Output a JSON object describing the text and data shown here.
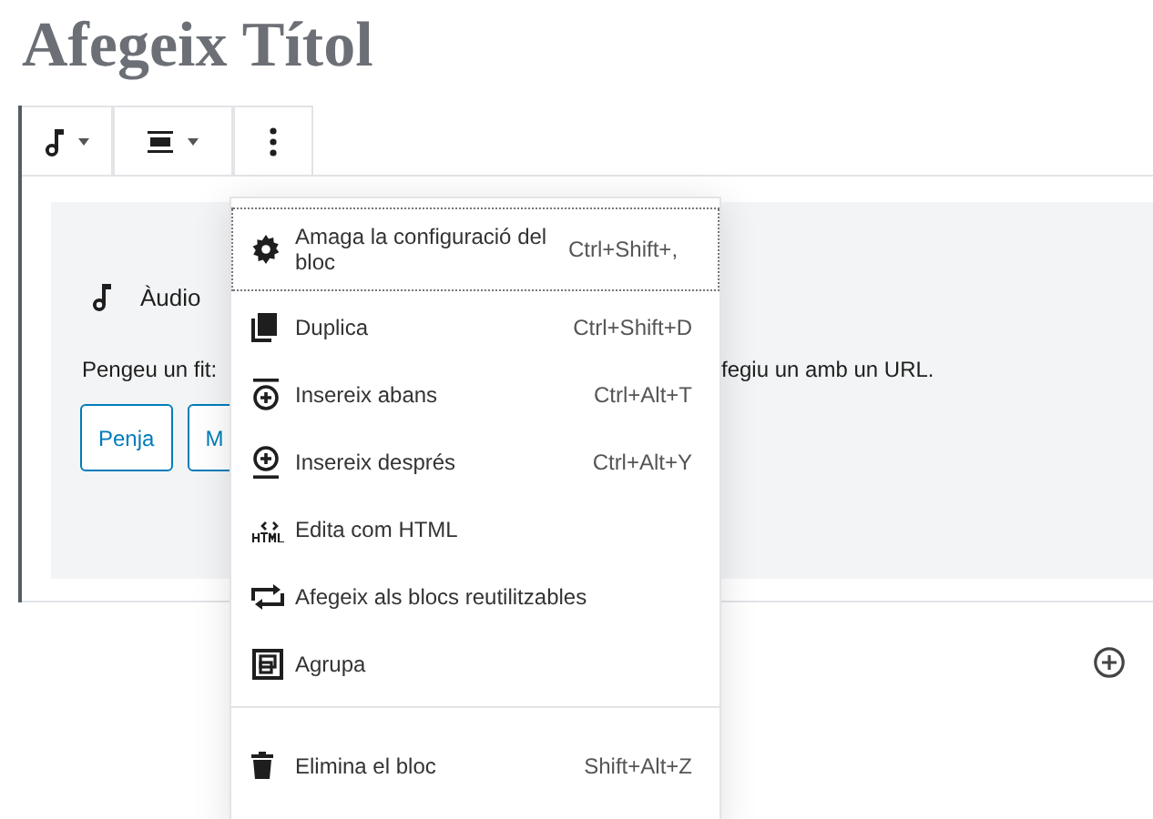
{
  "title": "Afegeix Títol",
  "block": {
    "label": "Àudio",
    "instructions": [
      "Pengeu un fit:",
      "fegiu un amb un URL."
    ],
    "buttons": [
      "Penja",
      "M"
    ]
  },
  "menu": {
    "items": [
      {
        "label": "Amaga la configuració del bloc",
        "shortcut": "Ctrl+Shift+,",
        "focused": true,
        "separator_before": false
      },
      {
        "label": "Duplica",
        "shortcut": "Ctrl+Shift+D",
        "focused": false,
        "separator_before": false
      },
      {
        "label": "Insereix abans",
        "shortcut": "Ctrl+Alt+T",
        "focused": false,
        "separator_before": false
      },
      {
        "label": "Insereix després",
        "shortcut": "Ctrl+Alt+Y",
        "focused": false,
        "separator_before": false
      },
      {
        "label": "Edita com HTML",
        "focused": false,
        "separator_before": false
      },
      {
        "label": "Afegeix als blocs reutilitzables",
        "focused": false,
        "separator_before": false
      },
      {
        "label": "Agrupa",
        "focused": false,
        "separator_before": false
      },
      {
        "label": "Elimina el bloc",
        "shortcut": "Shift+Alt+Z",
        "focused": false,
        "separator_before": true
      }
    ]
  }
}
